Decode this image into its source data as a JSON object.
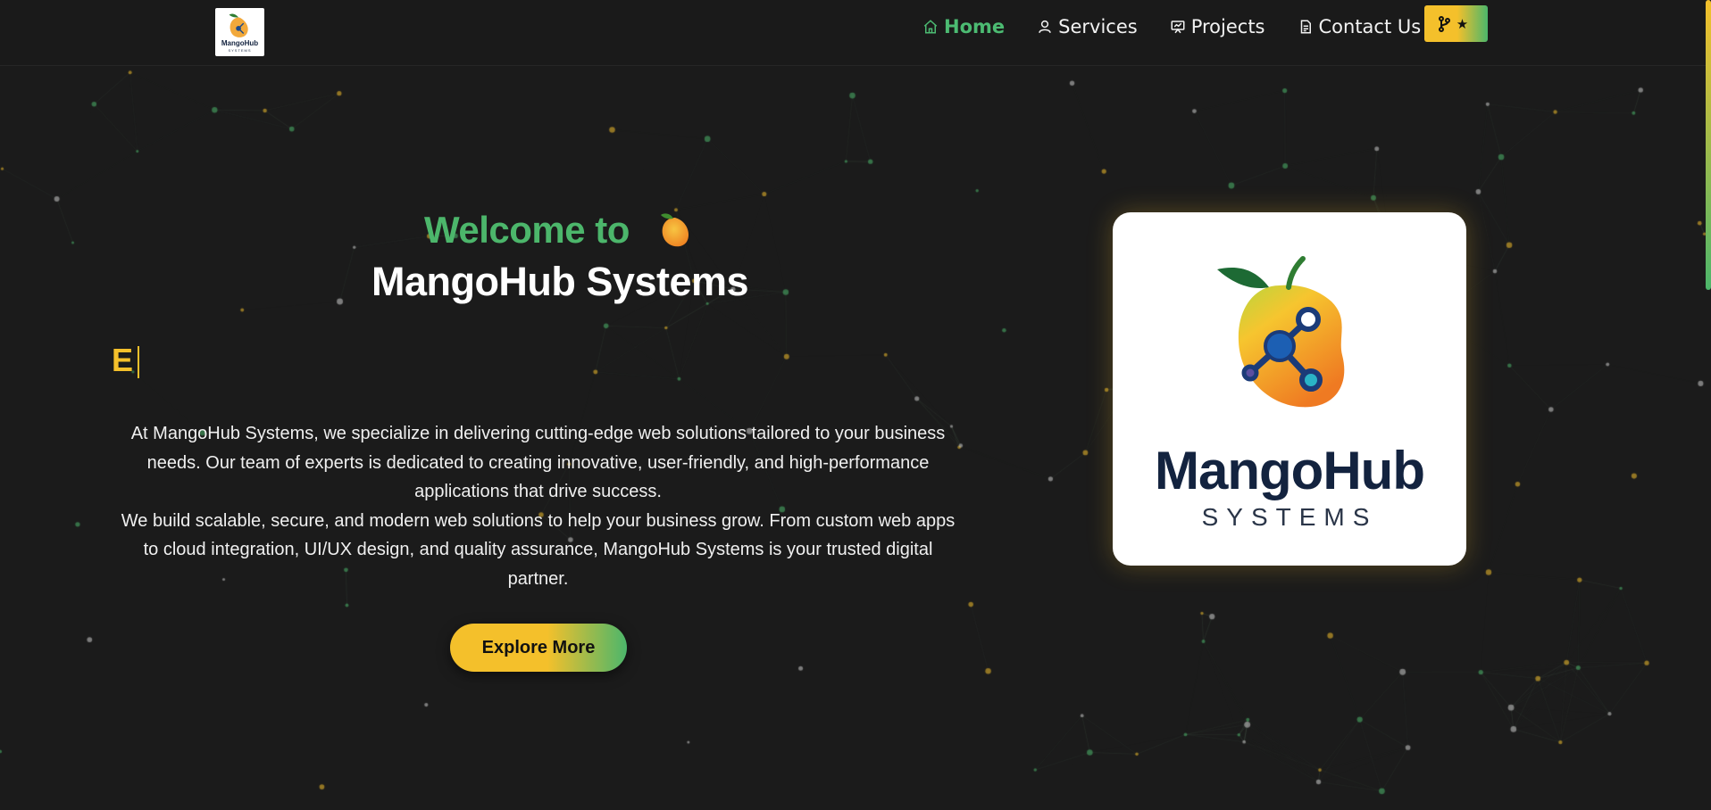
{
  "nav": {
    "logo": {
      "name": "MangoHub",
      "tagline": "SYSTEMS"
    },
    "items": [
      {
        "label": "Home",
        "icon": "home-icon",
        "active": true
      },
      {
        "label": "Services",
        "icon": "user-icon",
        "active": false
      },
      {
        "label": "Projects",
        "icon": "presentation-icon",
        "active": false
      },
      {
        "label": "Contact Us",
        "icon": "document-icon",
        "active": false
      }
    ],
    "github_button": {
      "icons": [
        "git-fork-icon",
        "star-icon"
      ]
    }
  },
  "hero": {
    "welcome": "Welcome to",
    "welcome_emoji": "mango-icon",
    "title": "MangoHub Systems",
    "typing_text": "E",
    "paragraphs": [
      "At MangoHub Systems, we specialize in delivering cutting-edge web solutions tailored to your business needs. Our team of experts is dedicated to creating innovative, user-friendly, and high-performance applications that drive success.",
      "We build scalable, secure, and modern web solutions to help your business grow. From custom web apps to cloud integration, UI/UX design, and quality assurance, MangoHub Systems is your trusted digital partner."
    ],
    "cta": "Explore More"
  },
  "logo_card": {
    "name": "MangoHub",
    "tagline": "SYSTEMS"
  },
  "colors": {
    "background": "#1b1b1b",
    "accent_green": "#4cb66b",
    "accent_yellow": "#f4c02b",
    "navy": "#13233f"
  }
}
